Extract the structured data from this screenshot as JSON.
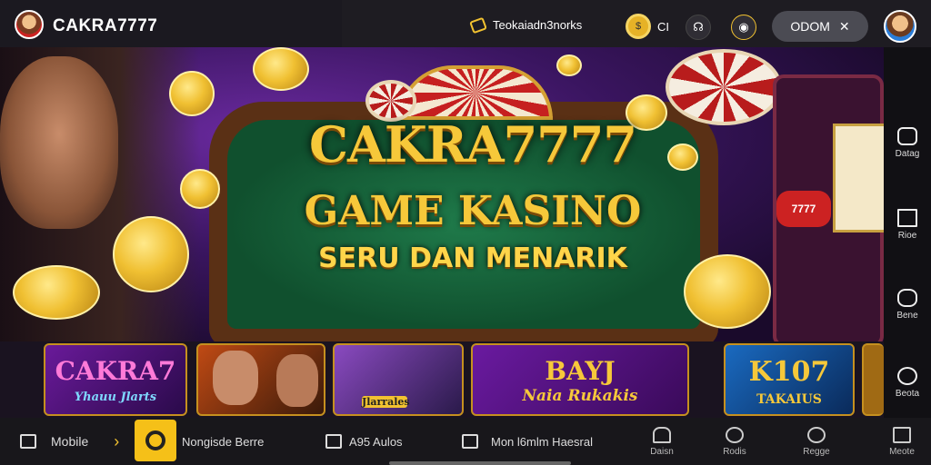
{
  "header": {
    "brand": "CAKRA7777",
    "promo_label": "Teokaiadn3norks",
    "coin_label": "CI",
    "cta_label": "ODOM",
    "cta_icon": "✕"
  },
  "hero": {
    "title_line1": "CAKRA7777",
    "title_line2": "GAME KASINO",
    "title_line3": "SERU DAN MENARIK",
    "slot_label": "7777"
  },
  "side_nav": [
    {
      "label": "Datag",
      "icon": "shield-icon"
    },
    {
      "label": "Rioe",
      "icon": "square-icon"
    },
    {
      "label": "Bene",
      "icon": "hexagon-icon"
    },
    {
      "label": "Beota",
      "icon": "chat-icon"
    }
  ],
  "cards": [
    {
      "title": "CAKRA7",
      "subtitle": "Yhauu Jlarts"
    },
    {
      "title": "",
      "subtitle": ""
    },
    {
      "title": "",
      "subtitle": "Jlarrales"
    },
    {
      "title": "BAYJ",
      "subtitle": "Naia Rukakis"
    },
    {
      "title": "K107",
      "subtitle": "TAKAIUS"
    }
  ],
  "bottom_bar": {
    "mobile_label": "Mobile",
    "chevron": "›",
    "highlight_label": "Nongisde Berre",
    "item3_label": "A95 Aulos",
    "item4_label": "Mon l6mlm Haesral",
    "icons": [
      {
        "label": "Daisn",
        "icon": "cloud-icon"
      },
      {
        "label": "Rodis",
        "icon": "search-icon"
      },
      {
        "label": "Regge",
        "icon": "search-icon"
      },
      {
        "label": "Meote",
        "icon": "menu-icon"
      }
    ]
  },
  "colors": {
    "accent_gold": "#f6c83a",
    "header_bg": "#1b1920",
    "highlight_yellow": "#f5c018"
  }
}
